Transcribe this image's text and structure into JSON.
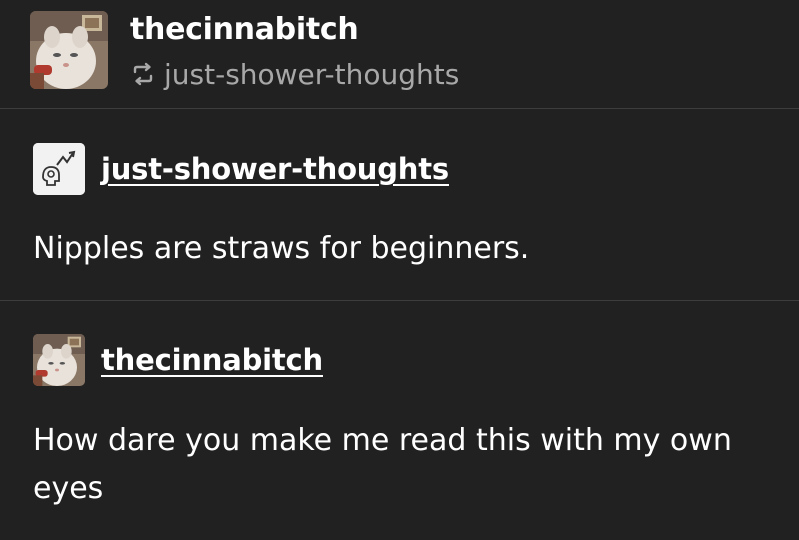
{
  "header": {
    "blog_name": "thecinnabitch",
    "reblogged_from": "just-shower-thoughts",
    "reblog_icon": "reblog-icon"
  },
  "posts": [
    {
      "author": "just-shower-thoughts",
      "avatar_icon": "rising-chart-head-icon",
      "text": "Nipples are straws for beginners."
    },
    {
      "author": "thecinnabitch",
      "avatar_icon": "cat-avatar",
      "text": "How dare you make me read this with my own eyes"
    }
  ],
  "colors": {
    "background": "#212121",
    "text": "#ffffff",
    "muted": "#a8a8a8",
    "divider": "#3d3d3d"
  }
}
